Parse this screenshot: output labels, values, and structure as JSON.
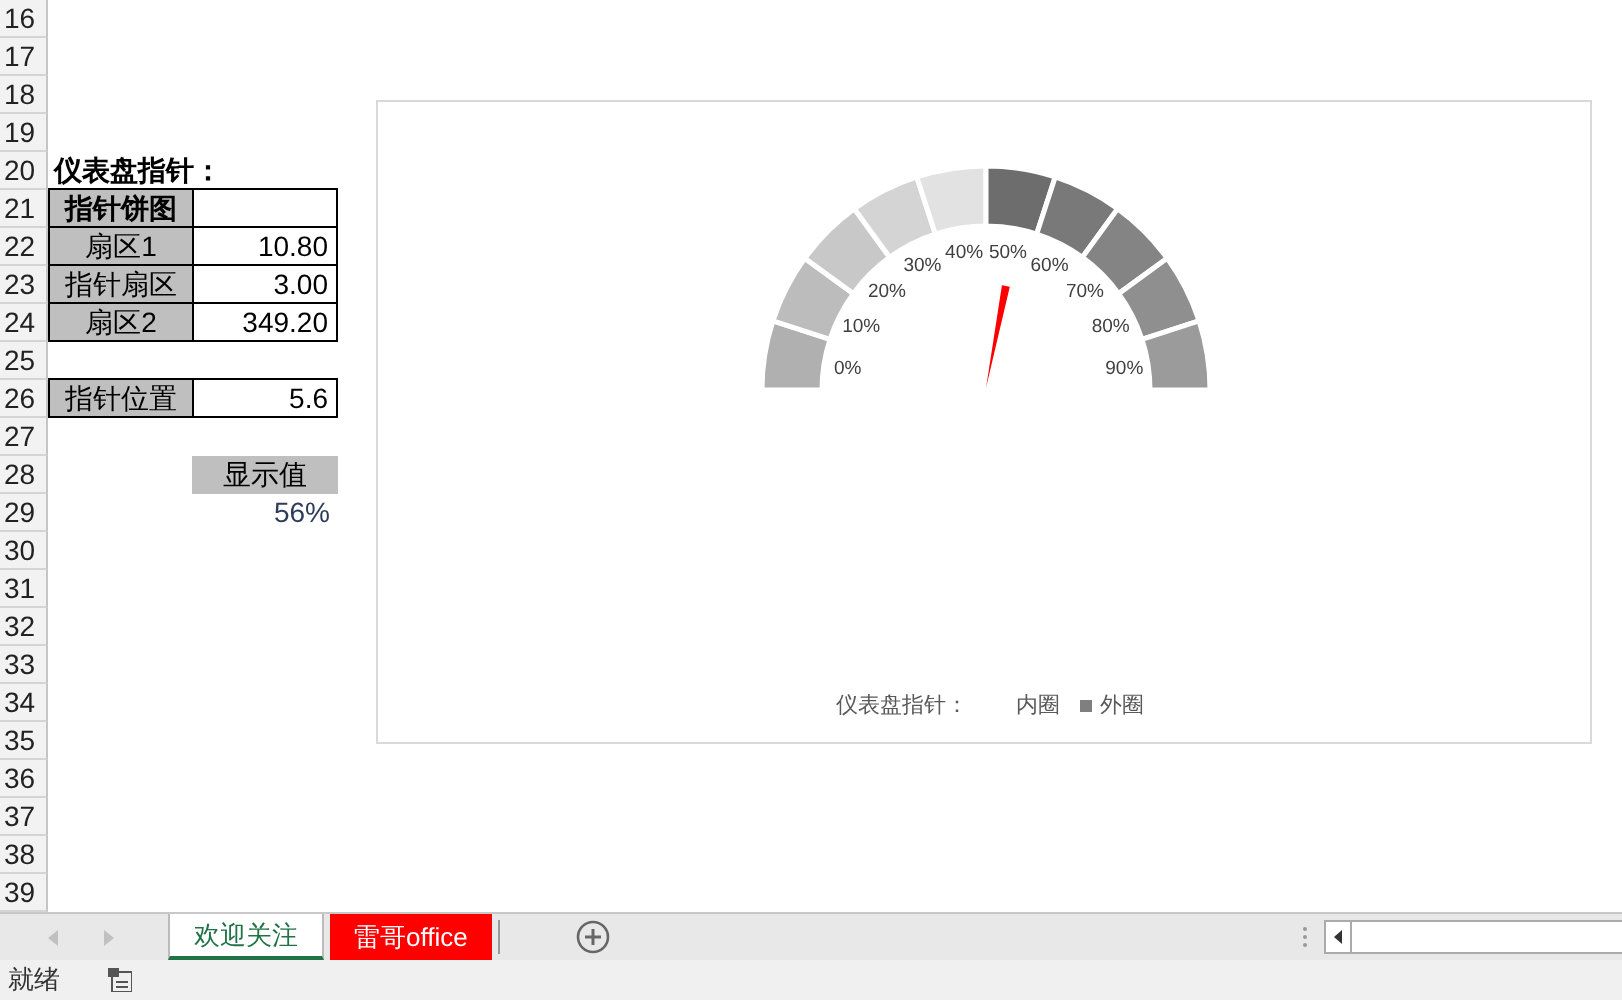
{
  "sheet": {
    "row_numbers": [
      "16",
      "17",
      "18",
      "19",
      "20",
      "21",
      "22",
      "23",
      "24",
      "25",
      "26",
      "27",
      "28",
      "29",
      "30",
      "31",
      "32",
      "33",
      "34",
      "35",
      "36",
      "37",
      "38",
      "39"
    ],
    "title": "仪表盘指针：",
    "table_header": "指针饼图",
    "table_rows": [
      {
        "label": "扇区1",
        "value": "10.80"
      },
      {
        "label": "指针扇区",
        "value": "3.00"
      },
      {
        "label": "扇区2",
        "value": "349.20"
      }
    ],
    "pointer": {
      "label": "指针位置",
      "value": "5.6"
    },
    "display": {
      "label": "显示值",
      "value": "56%"
    }
  },
  "chart": {
    "segments": [
      {
        "label": "0%",
        "color": "#b0b0b0"
      },
      {
        "label": "10%",
        "color": "#bcbcbc"
      },
      {
        "label": "20%",
        "color": "#c8c8c8"
      },
      {
        "label": "30%",
        "color": "#d4d4d4"
      },
      {
        "label": "40%",
        "color": "#e2e2e2"
      },
      {
        "label": "50%",
        "color": "#6d6d6d"
      },
      {
        "label": "60%",
        "color": "#797979"
      },
      {
        "label": "70%",
        "color": "#848484"
      },
      {
        "label": "80%",
        "color": "#8f8f8f"
      },
      {
        "label": "90%",
        "color": "#9b9b9b"
      }
    ],
    "needle": {
      "level": 0.56
    },
    "legend": {
      "title": "仪表盘指针：",
      "items": [
        {
          "label": "内圈",
          "marker": false
        },
        {
          "label": "外圈",
          "marker": true
        }
      ]
    }
  },
  "sheet_tabs": [
    {
      "label": "欢迎关注",
      "selected": true,
      "color": "#ffffff"
    },
    {
      "label": "雷哥office",
      "selected": false,
      "color": "#ff0000"
    }
  ],
  "status_bar": {
    "text": "就绪"
  }
}
